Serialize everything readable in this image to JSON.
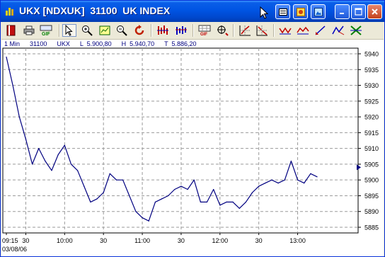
{
  "window": {
    "title": "UKX [NDXUK]  31100  UK INDEX",
    "buttons": [
      "sheet-button",
      "options-button",
      "picture-button",
      "minimize-icon",
      "maximize-icon",
      "close-icon"
    ]
  },
  "toolbar": {
    "tools": [
      "book-icon",
      "print-icon",
      "gif-export-icon",
      "pointer-icon",
      "zoom-in-icon",
      "zoom-box-icon",
      "zoom-out-icon",
      "refresh-icon",
      "bars-1-icon",
      "bars-2-icon",
      "grid-gif-icon",
      "target-icon",
      "trend-grid-1-icon",
      "trend-grid-2-icon",
      "line-tool-1-icon",
      "line-tool-2-icon",
      "pen-tool-icon",
      "zigzag-icon",
      "cross-icon"
    ]
  },
  "info": {
    "interval": "1 Min",
    "code": "31100",
    "symbol": "UKX",
    "low": "L  5.900,80",
    "high": "H  5.940,70",
    "last": "T  5.886,20"
  },
  "chart_data": {
    "type": "line",
    "title": "",
    "xlabel": "",
    "ylabel": "",
    "date": "03/08/06",
    "x_ticks": [
      "09:15",
      "30",
      "10:00",
      "30",
      "11:00",
      "30",
      "12:00",
      "30",
      "13:00"
    ],
    "y_ticks": [
      "5885",
      "5890",
      "5895",
      "5900",
      "5905",
      "5910",
      "5915",
      "5920",
      "5925",
      "5930",
      "5935",
      "5940"
    ],
    "ylim": [
      5884,
      5942
    ],
    "grid": true,
    "series": [
      {
        "x": [
          "09:15",
          "09:20",
          "09:25",
          "09:30",
          "09:35",
          "09:40",
          "09:45",
          "09:50",
          "09:55",
          "10:00",
          "10:05",
          "10:10",
          "10:15",
          "10:20",
          "10:25",
          "10:30",
          "10:35",
          "10:40",
          "10:45",
          "10:50",
          "10:55",
          "11:00",
          "11:05",
          "11:10",
          "11:15",
          "11:20",
          "11:25",
          "11:30",
          "11:35",
          "11:40",
          "11:45",
          "11:50",
          "11:55",
          "12:00",
          "12:05",
          "12:10",
          "12:15",
          "12:20",
          "12:25",
          "12:30",
          "12:35",
          "12:40",
          "12:45",
          "12:50",
          "12:55",
          "13:00",
          "13:05",
          "13:10",
          "13:15"
        ],
        "values": [
          5939,
          5930,
          5920,
          5913,
          5905,
          5910,
          5906,
          5903,
          5908,
          5911,
          5905,
          5903,
          5898,
          5893,
          5894,
          5896,
          5902,
          5900,
          5900,
          5895,
          5890,
          5888,
          5887,
          5893,
          5894,
          5895,
          5897,
          5898,
          5897,
          5900,
          5893,
          5893,
          5897,
          5892,
          5893,
          5893,
          5891,
          5893,
          5896,
          5898,
          5899,
          5900,
          5899,
          5900,
          5906,
          5900,
          5899,
          5902,
          5901
        ]
      }
    ]
  }
}
